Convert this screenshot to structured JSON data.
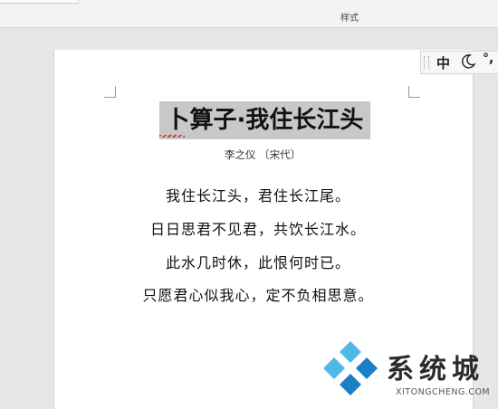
{
  "ribbon": {
    "group_label": "样式"
  },
  "document": {
    "title": "卜算子·我住长江头",
    "author": "李之仪 〔宋代〕",
    "lines": [
      "我住长江头，君住长江尾。",
      "日日思君不见君，共饮长江水。",
      "此水几时休，此恨何时已。",
      "只愿君心似我心，定不负相思意。"
    ]
  },
  "ime_toolbar": {
    "mode_label": "中",
    "moon_icon": "moon-icon",
    "punct_label": "°,"
  },
  "watermark": {
    "name": "系统城",
    "url": "XITONGCHENG.COM",
    "colors": {
      "light_blue": "#4fb8e8",
      "dark_blue": "#1a7fc4"
    }
  }
}
